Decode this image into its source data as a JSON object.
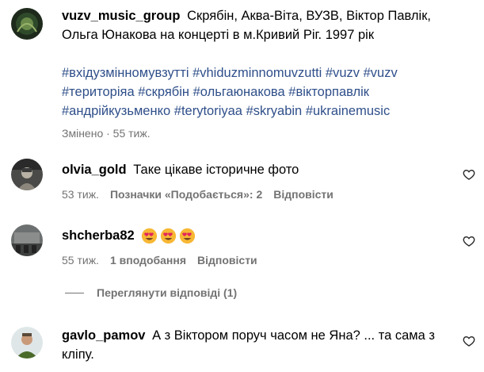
{
  "post": {
    "username": "vuzv_music_group",
    "caption": "Скрябін, Аква-Віта, ВУЗВ, Віктор Павлік, Ольга Юнакова на концерті в м.Кривий Ріг. 1997 рік",
    "hashtags": [
      "#вхідузмінномувзутті",
      "#vhiduzminnomuvzutti",
      "#vuzv",
      "#vuzv",
      "#територіяа",
      "#скрябін",
      "#ольгаюнакова",
      "#вікторпавлік",
      "#андрійкузьменко",
      "#terytoriyaa",
      "#skryabin",
      "#ukrainemusic"
    ],
    "meta": "Змінено · 55 тиж."
  },
  "comments": [
    {
      "username": "olvia_gold",
      "text": "Таке цікаве історичне фото",
      "time": "53 тиж.",
      "likes": "Позначки «Подобається»: 2",
      "reply": "Відповісти"
    },
    {
      "username": "shcherba82",
      "text": "",
      "emojis": [
        "heart-eyes",
        "heart-eyes",
        "heart-eyes"
      ],
      "time": "55 тиж.",
      "likes": "1 вподобання",
      "reply": "Відповісти"
    },
    {
      "username": "gavlo_pamov",
      "text": "А з Віктором поруч часом не Яна? ... та сама з кліпу."
    }
  ],
  "view_replies": "Переглянути відповіді (1)",
  "icons": {
    "heart": "heart-outline-icon",
    "emoji": "heart-eyes-emoji"
  },
  "colors": {
    "hashtag": "#2f4f8a",
    "meta": "#737373"
  }
}
